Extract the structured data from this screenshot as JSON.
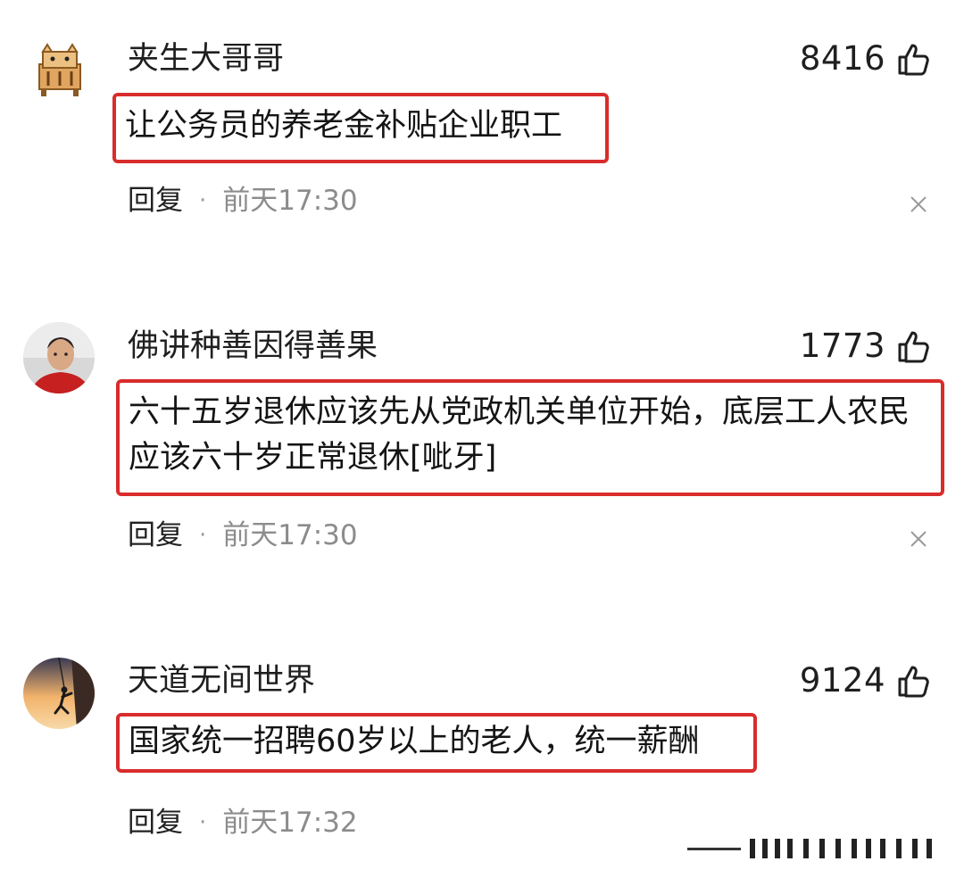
{
  "comments": [
    {
      "username": "夹生大哥哥",
      "likes": "8416",
      "text": "让公务员的养老金补贴企业职工",
      "reply_label": "回复",
      "separator": "·",
      "timestamp": "前天17:30",
      "avatar": "tiger-cartoon-avatar"
    },
    {
      "username": "佛讲种善因得善果",
      "likes": "1773",
      "text": "六十五岁退休应该先从党政机关单位开始，底层工人农民应该六十岁正常退休[呲牙]",
      "reply_label": "回复",
      "separator": "·",
      "timestamp": "前天17:30",
      "avatar": "man-portrait-avatar"
    },
    {
      "username": "天道无间世界",
      "likes": "9124",
      "text": "国家统一招聘60岁以上的老人，统一薪酬",
      "reply_label": "回复",
      "separator": "·",
      "timestamp": "前天17:32",
      "avatar": "climber-silhouette-avatar"
    }
  ],
  "icons": {
    "like": "thumbs-up-icon",
    "close": "close-icon"
  },
  "colors": {
    "highlight_border": "#d92c2c",
    "timestamp": "#8c8c8c"
  }
}
